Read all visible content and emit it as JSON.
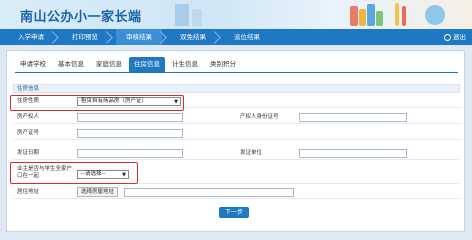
{
  "header": {
    "title": "南山公办小一家长端"
  },
  "nav": {
    "items": [
      {
        "label": "入学申请"
      },
      {
        "label": "打印预览"
      },
      {
        "label": "审核结果"
      },
      {
        "label": "双免结果"
      },
      {
        "label": "派位结果"
      }
    ],
    "active_index": 2,
    "exit_label": "退出"
  },
  "tabs": [
    {
      "label": "申请学校"
    },
    {
      "label": "基本信息"
    },
    {
      "label": "家庭信息"
    },
    {
      "label": "住房信息"
    },
    {
      "label": "计生信息"
    },
    {
      "label": "类别积分"
    }
  ],
  "active_tab": 3,
  "section": {
    "title": "住房信息"
  },
  "form": {
    "housing_type_label": "住房性质",
    "housing_type_value": "租赁自有商品房（房产证）",
    "owner_label": "房产权人",
    "owner_id_label": "产权人身份证号",
    "deed_no_label": "房产证号",
    "issue_date_label": "发证日期",
    "issuer_label": "发证单位",
    "same_household_label": "业主是否与学生全家户口在一起",
    "same_household_value": "--请选择--",
    "address_label": "居住地址",
    "address_button": "选择房屋地址"
  },
  "next_button": "下一步"
}
